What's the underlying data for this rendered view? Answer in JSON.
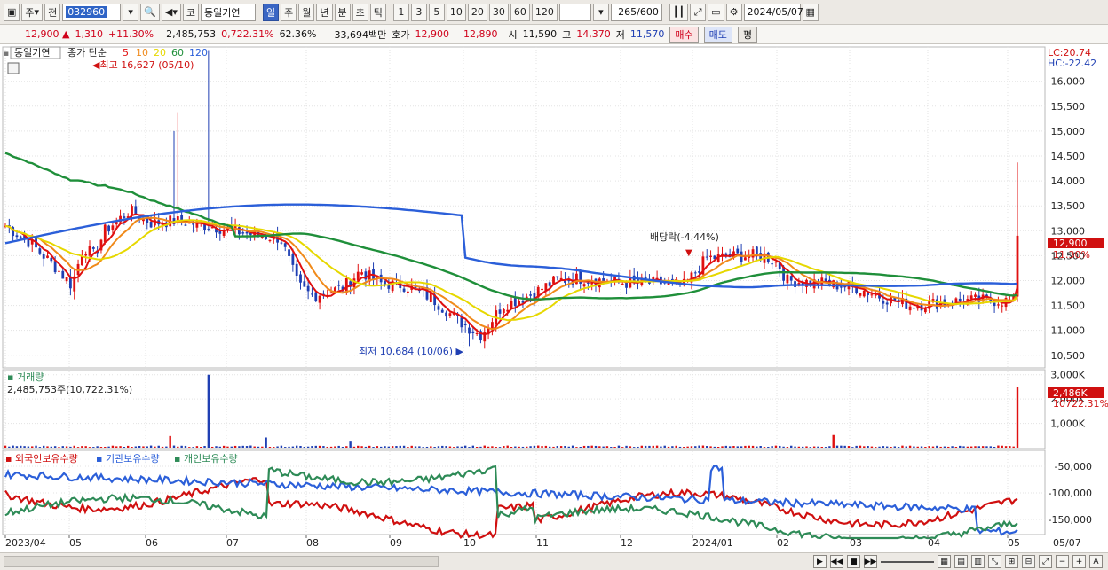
{
  "toolbar": {
    "market": "주",
    "prev": "전",
    "code": "032960",
    "type": "코",
    "name": "동일기연",
    "periods": [
      "일",
      "주",
      "월",
      "년",
      "분",
      "초",
      "틱"
    ],
    "active_period": "일",
    "intervals": [
      "1",
      "3",
      "5",
      "10",
      "20",
      "30",
      "60",
      "120"
    ],
    "count": "265",
    "count_max": "/600",
    "date": "2024/05/07"
  },
  "quote": {
    "price": "12,900",
    "change": "1,310",
    "change_pct": "+11.30%",
    "volume": "2,485,753",
    "vol_pct": "0,722.31%",
    "turnover_pct": "62.36%",
    "amount": "33,694백만",
    "bid_label": "호가",
    "bid1": "12,900",
    "bid2": "12,890",
    "open_label": "시",
    "open": "11,590",
    "high_label": "고",
    "high": "14,370",
    "low_label": "저",
    "low": "11,570",
    "buy_btn": "매수",
    "sell_btn": "매도",
    "eval_btn": "평"
  },
  "price_panel": {
    "name_tag": "동일기연",
    "legend_prefix": "종가 단순",
    "ma": [
      {
        "label": "5",
        "color": "#e01010"
      },
      {
        "label": "10",
        "color": "#f08a1a"
      },
      {
        "label": "20",
        "color": "#e6d800"
      },
      {
        "label": "60",
        "color": "#1f8f3a"
      },
      {
        "label": "120",
        "color": "#2b5fd9"
      }
    ],
    "high_note": "최고 16,627 (05/10)",
    "low_note": "최저 10,684 (10/06)",
    "dividend_note": "배당락(-4.44%)",
    "lc": "LC:20.74",
    "hc": "HC:-22.42",
    "y_ticks": [
      "16,000",
      "15,500",
      "15,000",
      "14,500",
      "14,000",
      "13,500",
      "13,000",
      "12,500",
      "12,000",
      "11,500",
      "11,000",
      "10,500"
    ],
    "last_price": "12,900",
    "last_pct": "11.30%"
  },
  "volume_panel": {
    "title": "거래량",
    "value": "2,485,753주(10,722.31%)",
    "y_ticks": [
      "3,000K",
      "2,000K",
      "1,000K"
    ],
    "last": "2,486K",
    "last_pct": "10722.31%"
  },
  "holding_panel": {
    "legend": [
      {
        "label": "외국인보유수량",
        "color": "#d01010"
      },
      {
        "label": "기관보유수량",
        "color": "#2b5fd9"
      },
      {
        "label": "개인보유수량",
        "color": "#2e8b57"
      }
    ],
    "y_ticks": [
      "-50,000",
      "-100,000",
      "-150,000"
    ]
  },
  "x_axis": [
    "2023/04",
    "05",
    "06",
    "07",
    "08",
    "09",
    "10",
    "11",
    "12",
    "2024/01",
    "02",
    "03",
    "04",
    "05"
  ],
  "x_right": "05/07",
  "colors": {
    "up": "#e01010",
    "down": "#1f3fb3",
    "grid": "#e3e3e3"
  }
}
